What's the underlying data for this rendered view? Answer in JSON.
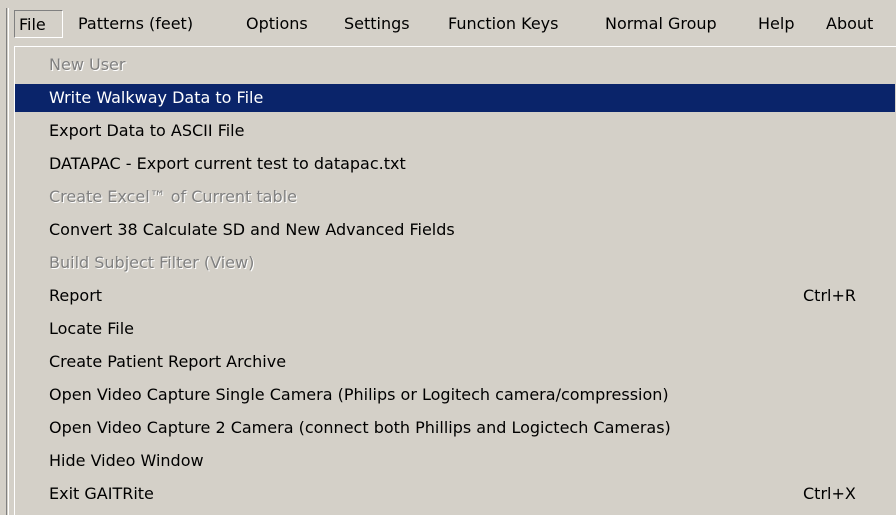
{
  "menubar": {
    "items": [
      {
        "label": "File"
      },
      {
        "label": "Patterns (feet)"
      },
      {
        "label": "Options"
      },
      {
        "label": "Settings"
      },
      {
        "label": "Function Keys"
      },
      {
        "label": "Normal Group"
      },
      {
        "label": "Help"
      },
      {
        "label": "About"
      }
    ]
  },
  "file_menu": {
    "items": [
      {
        "label": "New User",
        "shortcut": "",
        "state": "disabled"
      },
      {
        "label": "Write Walkway Data to File",
        "shortcut": "",
        "state": "selected"
      },
      {
        "label": "Export Data to ASCII File",
        "shortcut": "",
        "state": "enabled"
      },
      {
        "label": "DATAPAC - Export current test to datapac.txt",
        "shortcut": "",
        "state": "enabled"
      },
      {
        "label": "Create Excel™ of  Current table",
        "shortcut": "",
        "state": "disabled"
      },
      {
        "label": "Convert 38 Calculate SD and New Advanced Fields",
        "shortcut": "",
        "state": "enabled"
      },
      {
        "label": "Build Subject Filter (View)",
        "shortcut": "",
        "state": "disabled"
      },
      {
        "label": "Report",
        "shortcut": "Ctrl+R",
        "state": "enabled"
      },
      {
        "label": "Locate File",
        "shortcut": "",
        "state": "enabled"
      },
      {
        "label": "Create Patient Report Archive",
        "shortcut": "",
        "state": "enabled"
      },
      {
        "label": "Open Video Capture Single Camera  (Philips or Logitech camera/compression)",
        "shortcut": "",
        "state": "enabled"
      },
      {
        "label": "Open Video Capture 2 Camera (connect both Phillips and Logictech Cameras)",
        "shortcut": "",
        "state": "enabled"
      },
      {
        "label": "Hide Video Window",
        "shortcut": "",
        "state": "enabled"
      },
      {
        "label": "Exit GAITRite",
        "shortcut": "Ctrl+X",
        "state": "enabled"
      }
    ]
  },
  "colors": {
    "face": "#d4d0c8",
    "highlight": "#0a246a",
    "disabled_text": "#808080"
  }
}
